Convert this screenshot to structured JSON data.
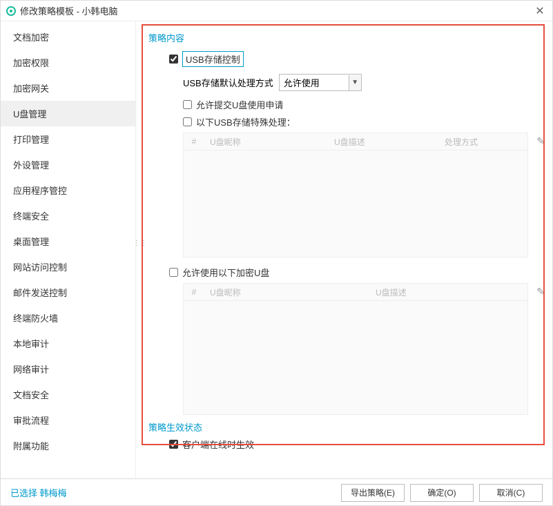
{
  "title": "修改策略模板 - 小韩电脑",
  "sidebar": {
    "items": [
      {
        "label": "文档加密"
      },
      {
        "label": "加密权限"
      },
      {
        "label": "加密网关"
      },
      {
        "label": "U盘管理",
        "active": true
      },
      {
        "label": "打印管理"
      },
      {
        "label": "外设管理"
      },
      {
        "label": "应用程序管控"
      },
      {
        "label": "终端安全"
      },
      {
        "label": "桌面管理"
      },
      {
        "label": "网站访问控制"
      },
      {
        "label": "邮件发送控制"
      },
      {
        "label": "终端防火墙"
      },
      {
        "label": "本地审计"
      },
      {
        "label": "网络审计"
      },
      {
        "label": "文档安全"
      },
      {
        "label": "审批流程"
      },
      {
        "label": "附属功能"
      }
    ]
  },
  "section1": {
    "title": "策略内容",
    "usb_control": {
      "label": "USB存储控制",
      "checked": true
    },
    "default_mode": {
      "label": "USB存储默认处理方式",
      "value": "允许使用"
    },
    "allow_apply": {
      "label": "允许提交U盘使用申请",
      "checked": false
    },
    "special": {
      "label": "以下USB存储特殊处理：",
      "checked": false
    },
    "table1": {
      "cols": {
        "num": "#",
        "name": "U盘昵称",
        "desc": "U盘描述",
        "mode": "处理方式"
      }
    },
    "allow_encrypted": {
      "label": "允许使用以下加密U盘",
      "checked": false
    },
    "table2": {
      "cols": {
        "num": "#",
        "name": "U盘昵称",
        "desc": "U盘描述"
      }
    }
  },
  "section2": {
    "title": "策略生效状态",
    "online": {
      "label": "客户端在线时生效",
      "checked": true
    }
  },
  "footer": {
    "selected_prefix": "已选择 ",
    "selected_name": "韩梅梅",
    "export": "导出策略(E)",
    "ok": "确定(O)",
    "cancel": "取消(C)"
  }
}
